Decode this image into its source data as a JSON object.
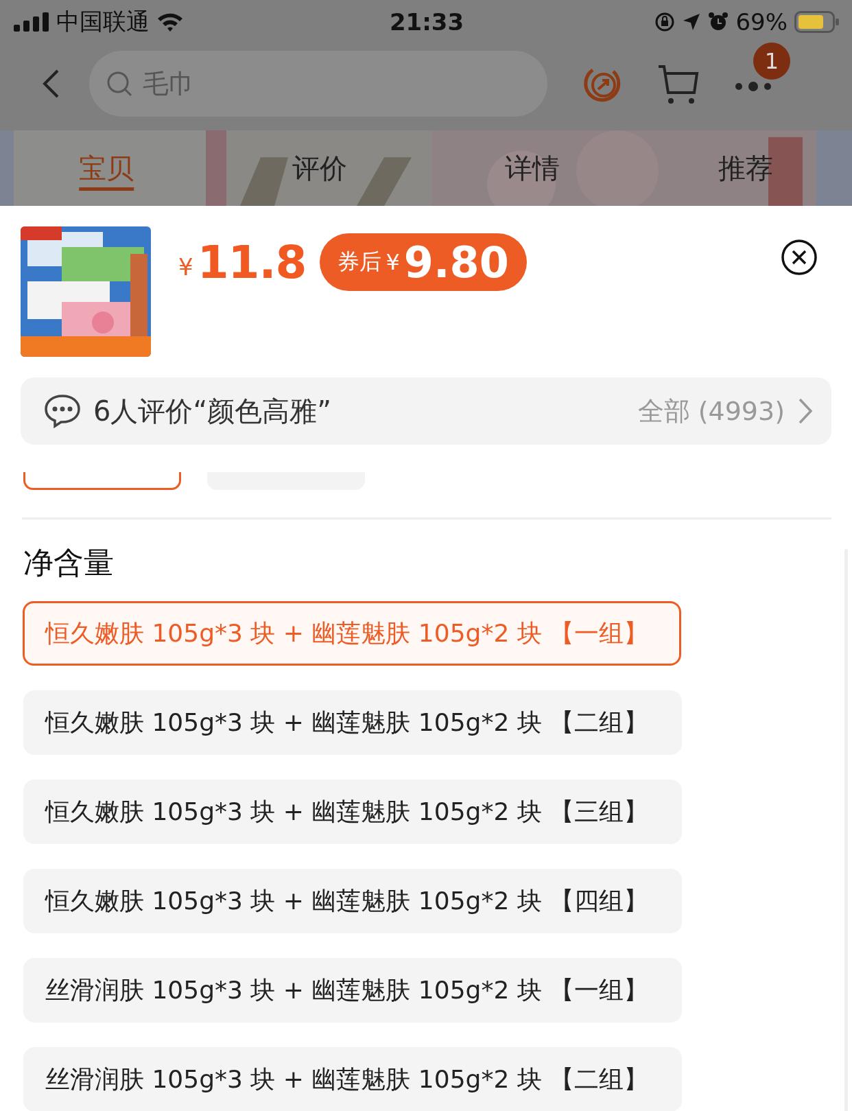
{
  "status_bar": {
    "carrier": "中国联通",
    "time": "21:33",
    "battery": "69%"
  },
  "nav": {
    "search": {
      "placeholder": "毛巾"
    },
    "badge": "1"
  },
  "tabs": [
    {
      "label": "宝贝",
      "selected": true
    },
    {
      "label": "评价",
      "selected": false
    },
    {
      "label": "详情",
      "selected": false
    },
    {
      "label": "推荐",
      "selected": false
    }
  ],
  "product": {
    "currency": "¥",
    "price": "11.8",
    "coupon": {
      "label": "券后",
      "currency": "¥",
      "price": "9.80"
    }
  },
  "review_bar": {
    "text": "6人评价“颜色高雅”",
    "all": "全部 (4993)"
  },
  "previous_options": [
    {
      "selected": true
    },
    {
      "selected": false
    }
  ],
  "section_title": "净含量",
  "options": [
    {
      "label": "恒久嫩肤 105g*3 块 + 幽莲魅肤 105g*2 块 【一组】",
      "selected": true
    },
    {
      "label": "恒久嫩肤 105g*3 块 + 幽莲魅肤 105g*2 块 【二组】",
      "selected": false
    },
    {
      "label": "恒久嫩肤 105g*3 块 + 幽莲魅肤 105g*2 块 【三组】",
      "selected": false
    },
    {
      "label": "恒久嫩肤 105g*3 块 + 幽莲魅肤 105g*2 块 【四组】",
      "selected": false
    },
    {
      "label": "丝滑润肤 105g*3 块 + 幽莲魅肤 105g*2 块 【一组】",
      "selected": false
    },
    {
      "label": "丝滑润肤 105g*3 块 + 幽莲魅肤 105g*2 块 【二组】",
      "selected": false
    }
  ]
}
